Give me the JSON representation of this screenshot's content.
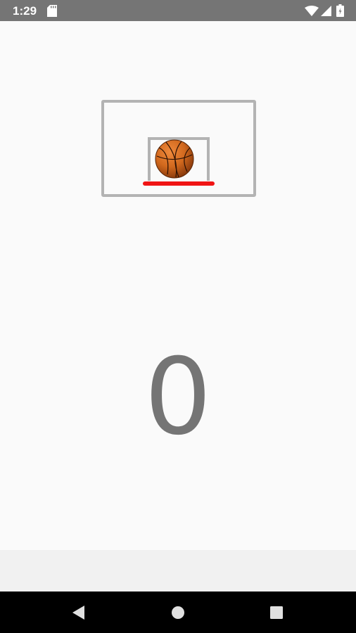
{
  "status_bar": {
    "time": "1:29",
    "icons": [
      "sd-card-icon",
      "wifi-icon",
      "signal-icon",
      "battery-icon"
    ]
  },
  "game": {
    "score": "0",
    "colors": {
      "backboard": "#b3b3b3",
      "rim": "#f01414",
      "ball": "#d2691e",
      "score_text": "#757575"
    },
    "ball_icon": "basketball-icon"
  },
  "nav_bar": {
    "buttons": [
      "back-icon",
      "home-icon",
      "recents-icon"
    ]
  }
}
